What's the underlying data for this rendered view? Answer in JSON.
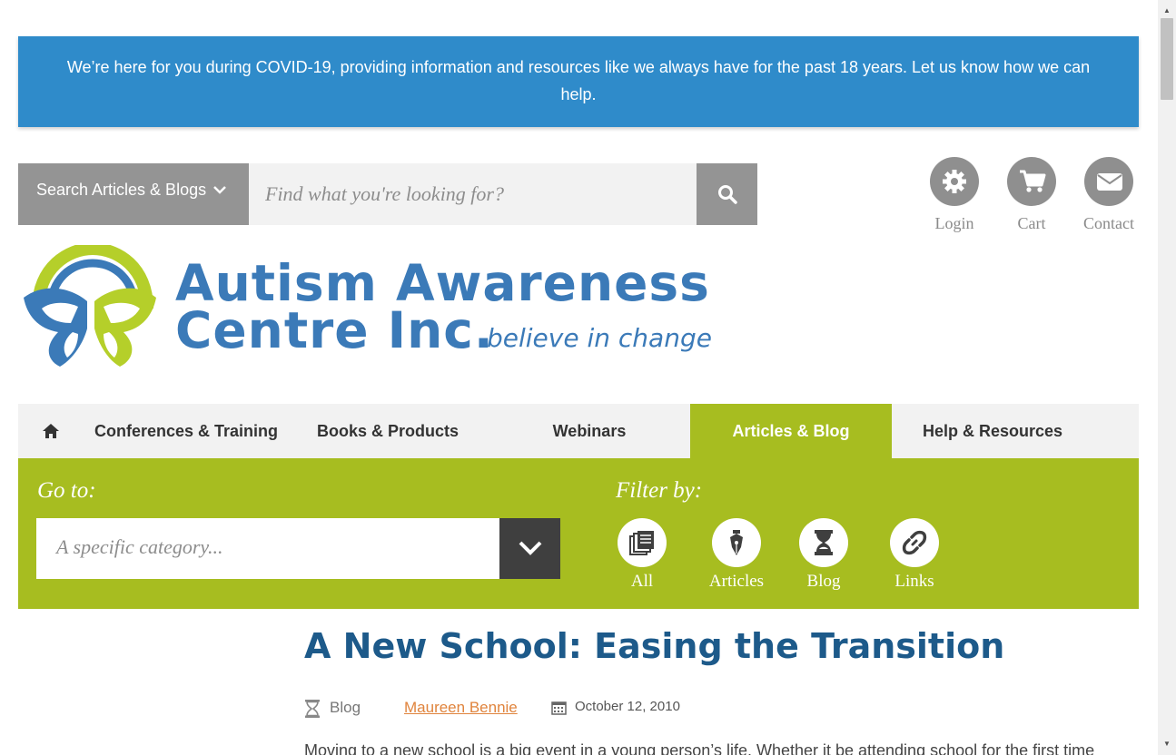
{
  "banner": {
    "text": "We’re here for you during COVID-19, providing information and resources like we always have for the past 18 years. Let us know how we can help."
  },
  "search": {
    "dropdown_label": "Search Articles & Blogs",
    "placeholder": "Find what you're looking for?",
    "button_icon": "search-icon"
  },
  "utility": [
    {
      "label": "Login",
      "icon": "gear-icon"
    },
    {
      "label": "Cart",
      "icon": "cart-icon"
    },
    {
      "label": "Contact",
      "icon": "mail-icon"
    }
  ],
  "logo": {
    "line1": "Autism Awareness",
    "line2": "Centre Inc.",
    "tagline": "believe in change",
    "colors": {
      "blue": "#3b7ab8",
      "green": "#b5cf2a"
    }
  },
  "nav": {
    "home_icon": "home-icon",
    "items": [
      {
        "label": "Conferences & Training",
        "active": false
      },
      {
        "label": "Books & Products",
        "active": false
      },
      {
        "label": "Webinars",
        "active": false
      },
      {
        "label": "Articles & Blog",
        "active": true
      },
      {
        "label": "Help & Resources",
        "active": false
      }
    ]
  },
  "filter_panel": {
    "goto_label": "Go to:",
    "category_placeholder": "A specific category...",
    "filter_label": "Filter by:",
    "filters": [
      {
        "label": "All",
        "icon": "documents-icon"
      },
      {
        "label": "Articles",
        "icon": "pen-nib-icon"
      },
      {
        "label": "Blog",
        "icon": "hourglass-icon"
      },
      {
        "label": "Links",
        "icon": "link-icon"
      }
    ]
  },
  "article": {
    "title": "A New School: Easing the Transition",
    "type": "Blog",
    "author": "Maureen Bennie",
    "date": "October 12, 2010",
    "body_start": "Moving to a new school is a big event in a young person’s life. Whether it be attending school for the first time"
  },
  "colors": {
    "banner_blue": "#2f8bca",
    "accent_green": "#a7bd20",
    "title_blue": "#1d5a8a",
    "author_orange": "#e0843d"
  }
}
